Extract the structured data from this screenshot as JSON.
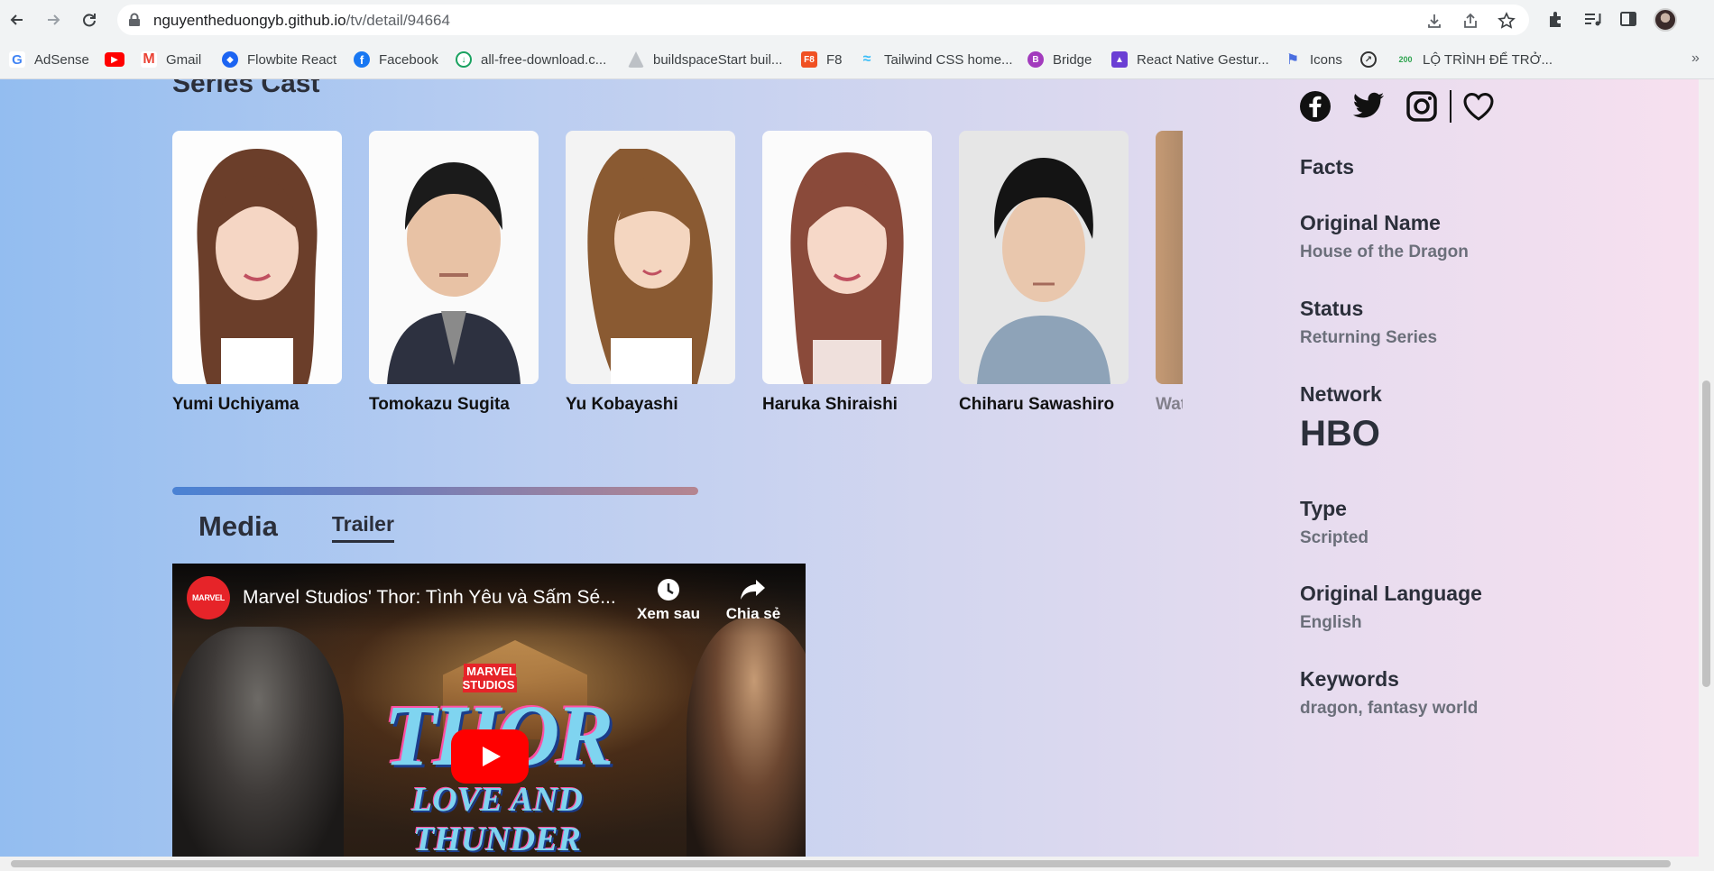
{
  "browser": {
    "url_host": "nguyentheduongyb.github.io",
    "url_path": "/tv/detail/94664",
    "bookmarks": [
      {
        "label": "AdSense",
        "icon": "google-icon",
        "color": "#4285f4"
      },
      {
        "label": "",
        "icon": "youtube-icon",
        "color": "#ff0000"
      },
      {
        "label": "Gmail",
        "icon": "gmail-icon",
        "color": "#ea4335"
      },
      {
        "label": "Flowbite React",
        "icon": "flowbite-icon",
        "color": "#1c64f2"
      },
      {
        "label": "Facebook",
        "icon": "facebook-icon",
        "color": "#1877f2"
      },
      {
        "label": "all-free-download.c...",
        "icon": "download-icon",
        "color": "#1aa260"
      },
      {
        "label": "buildspaceStart buil...",
        "icon": "buildspace-icon",
        "color": "#9aa0a6"
      },
      {
        "label": "F8",
        "icon": "f8-icon",
        "color": "#f05123"
      },
      {
        "label": "Tailwind CSS home...",
        "icon": "tailwind-icon",
        "color": "#38bdf8"
      },
      {
        "label": "Bridge",
        "icon": "bridge-icon",
        "color": "#a23bbd"
      },
      {
        "label": "React Native Gestur...",
        "icon": "react-native-icon",
        "color": "#6b3fd4"
      },
      {
        "label": "Icons",
        "icon": "flag-icon",
        "color": "#4a6ee0"
      },
      {
        "label": "",
        "icon": "compass-icon",
        "color": "#333333"
      },
      {
        "label": "LỘ TRÌNH ĐỂ TRỞ...",
        "icon": "200lab-icon",
        "color": "#2ea44f"
      }
    ]
  },
  "cast": {
    "title": "Series Cast",
    "members": [
      {
        "name": "Yumi Uchiyama"
      },
      {
        "name": "Tomokazu Sugita"
      },
      {
        "name": "Yu Kobayashi"
      },
      {
        "name": "Haruka Shiraishi"
      },
      {
        "name": "Chiharu Sawashiro"
      },
      {
        "name": "Wat"
      }
    ]
  },
  "media": {
    "tab_media": "Media",
    "tab_trailer": "Trailer",
    "video": {
      "channel_badge": "MARVEL",
      "title": "Marvel Studios' Thor: Tình Yêu và Sấm Sé...",
      "watch_later": "Xem sau",
      "share": "Chia sẻ",
      "studio_text": "MARVEL STUDIOS",
      "logo_text": "THOR",
      "logo_subtitle": "LOVE AND THUNDER"
    }
  },
  "facts": {
    "heading": "Facts",
    "items": [
      {
        "label": "Original Name",
        "value": "House of the Dragon"
      },
      {
        "label": "Status",
        "value": "Returning Series"
      },
      {
        "label": "Network",
        "value": "HBO"
      },
      {
        "label": "Type",
        "value": "Scripted"
      },
      {
        "label": "Original Language",
        "value": "English"
      },
      {
        "label": "Keywords",
        "value": "dragon, fantasy world"
      }
    ]
  }
}
